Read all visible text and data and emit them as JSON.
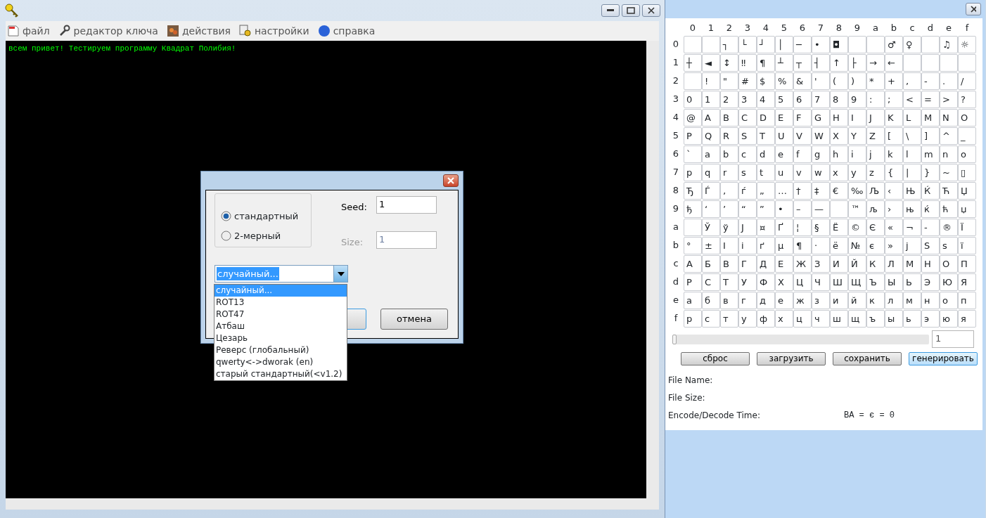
{
  "main_window": {
    "menu": [
      {
        "label": "файл"
      },
      {
        "label": "редактор ключа"
      },
      {
        "label": "действия"
      },
      {
        "label": "настройки"
      },
      {
        "label": "справка"
      }
    ],
    "console": {
      "lines": [
        "всем привет! Тестируем программу Квадрат Полибия!"
      ]
    },
    "dialog": {
      "modes": [
        {
          "label": "стандартный",
          "selected": true
        },
        {
          "label": "2-мерный",
          "selected": false
        }
      ],
      "fields": [
        {
          "label": "Seed:",
          "value": "1",
          "disabled": false
        },
        {
          "label": "Size:",
          "value": "1",
          "disabled": true
        }
      ],
      "combo": {
        "value": "случайный...",
        "expanded": true,
        "options": [
          {
            "label": "случайный...",
            "selected": true
          },
          {
            "label": "ROT13",
            "selected": false
          },
          {
            "label": "ROT47",
            "selected": false
          },
          {
            "label": "Атбаш",
            "selected": false
          },
          {
            "label": "Цезарь",
            "selected": false
          },
          {
            "label": "Реверс (глобальный)",
            "selected": false
          },
          {
            "label": "qwerty<->dworak (en)",
            "selected": false
          },
          {
            "label": "старый стандартный(<v1.2)",
            "selected": false
          }
        ]
      },
      "buttons": [
        {
          "kind": "default"
        },
        {
          "kind": "normal",
          "label": "отмена"
        }
      ]
    }
  },
  "table_window": {
    "column_headers": [
      "0",
      "1",
      "2",
      "3",
      "4",
      "5",
      "6",
      "7",
      "8",
      "9",
      "a",
      "b",
      "c",
      "d",
      "e",
      "f"
    ],
    "rows": [
      {
        "label": "0",
        "cells": [
          null,
          null,
          "┐",
          "└",
          "┘",
          "│",
          "─",
          "•",
          "◘",
          null,
          null,
          "♂",
          "♀",
          null,
          "♫",
          "☼"
        ]
      },
      {
        "label": "1",
        "cells": [
          "┼",
          "◄",
          "↕",
          "‼",
          "¶",
          "┴",
          "┬",
          "┤",
          "↑",
          "├",
          "→",
          "←",
          null,
          null,
          null,
          null
        ]
      },
      {
        "label": "2",
        "cells": [
          null,
          "!",
          "\"",
          "#",
          "$",
          "%",
          "&",
          "'",
          "(",
          ")",
          "*",
          "+",
          ",",
          "-",
          ".",
          "/"
        ]
      },
      {
        "label": "3",
        "cells": [
          "0",
          "1",
          "2",
          "3",
          "4",
          "5",
          "6",
          "7",
          "8",
          "9",
          ":",
          ";",
          "<",
          "=",
          ">",
          "?"
        ]
      },
      {
        "label": "4",
        "cells": [
          "@",
          "A",
          "B",
          "C",
          "D",
          "E",
          "F",
          "G",
          "H",
          "I",
          "J",
          "K",
          "L",
          "M",
          "N",
          "O"
        ]
      },
      {
        "label": "5",
        "cells": [
          "P",
          "Q",
          "R",
          "S",
          "T",
          "U",
          "V",
          "W",
          "X",
          "Y",
          "Z",
          "[",
          "\\",
          "]",
          "^",
          "_"
        ]
      },
      {
        "label": "6",
        "cells": [
          "`",
          "a",
          "b",
          "c",
          "d",
          "e",
          "f",
          "g",
          "h",
          "i",
          "j",
          "k",
          "l",
          "m",
          "n",
          "o"
        ]
      },
      {
        "label": "7",
        "cells": [
          "p",
          "q",
          "r",
          "s",
          "t",
          "u",
          "v",
          "w",
          "x",
          "y",
          "z",
          "{",
          "|",
          "}",
          "~",
          "▯"
        ]
      },
      {
        "label": "8",
        "cells": [
          "Ђ",
          "Ѓ",
          "‚",
          "ѓ",
          "„",
          "…",
          "†",
          "‡",
          "€",
          "‰",
          "Љ",
          "‹",
          "Њ",
          "Ќ",
          "Ћ",
          "Џ"
        ]
      },
      {
        "label": "9",
        "cells": [
          "ђ",
          "‘",
          "’",
          "“",
          "”",
          "•",
          "–",
          "—",
          null,
          "™",
          "љ",
          "›",
          "њ",
          "ќ",
          "ћ",
          "џ"
        ]
      },
      {
        "label": "a",
        "cells": [
          null,
          "Ў",
          "ў",
          "Ј",
          "¤",
          "Ґ",
          "¦",
          "§",
          "Ё",
          "©",
          "Є",
          "«",
          "¬",
          "-",
          "®",
          "Ї"
        ]
      },
      {
        "label": "b",
        "cells": [
          "°",
          "±",
          "І",
          "і",
          "ґ",
          "µ",
          "¶",
          "·",
          "ё",
          "№",
          "є",
          "»",
          "ј",
          "Ѕ",
          "ѕ",
          "ї"
        ]
      },
      {
        "label": "c",
        "cells": [
          "А",
          "Б",
          "В",
          "Г",
          "Д",
          "Е",
          "Ж",
          "З",
          "И",
          "Й",
          "К",
          "Л",
          "М",
          "Н",
          "О",
          "П"
        ]
      },
      {
        "label": "d",
        "cells": [
          "Р",
          "С",
          "Т",
          "У",
          "Ф",
          "Х",
          "Ц",
          "Ч",
          "Ш",
          "Щ",
          "Ъ",
          "Ы",
          "Ь",
          "Э",
          "Ю",
          "Я"
        ]
      },
      {
        "label": "e",
        "cells": [
          "а",
          "б",
          "в",
          "г",
          "д",
          "е",
          "ж",
          "з",
          "и",
          "й",
          "к",
          "л",
          "м",
          "н",
          "о",
          "п"
        ]
      },
      {
        "label": "f",
        "cells": [
          "р",
          "с",
          "т",
          "у",
          "ф",
          "х",
          "ц",
          "ч",
          "ш",
          "щ",
          "ъ",
          "ы",
          "ь",
          "э",
          "ю",
          "я"
        ]
      }
    ],
    "slider": {
      "level": 0,
      "value": "1"
    },
    "buttons": [
      {
        "label": "сброс",
        "focused": false
      },
      {
        "label": "загрузить",
        "focused": false
      },
      {
        "label": "сохранить",
        "focused": false
      },
      {
        "label": "генерировать",
        "focused": true
      }
    ],
    "info": [
      {
        "label": "File Name:"
      },
      {
        "label": "File Size:"
      },
      {
        "label": "Encode/Decode Time:",
        "value": "ВА = є = 0"
      }
    ]
  }
}
